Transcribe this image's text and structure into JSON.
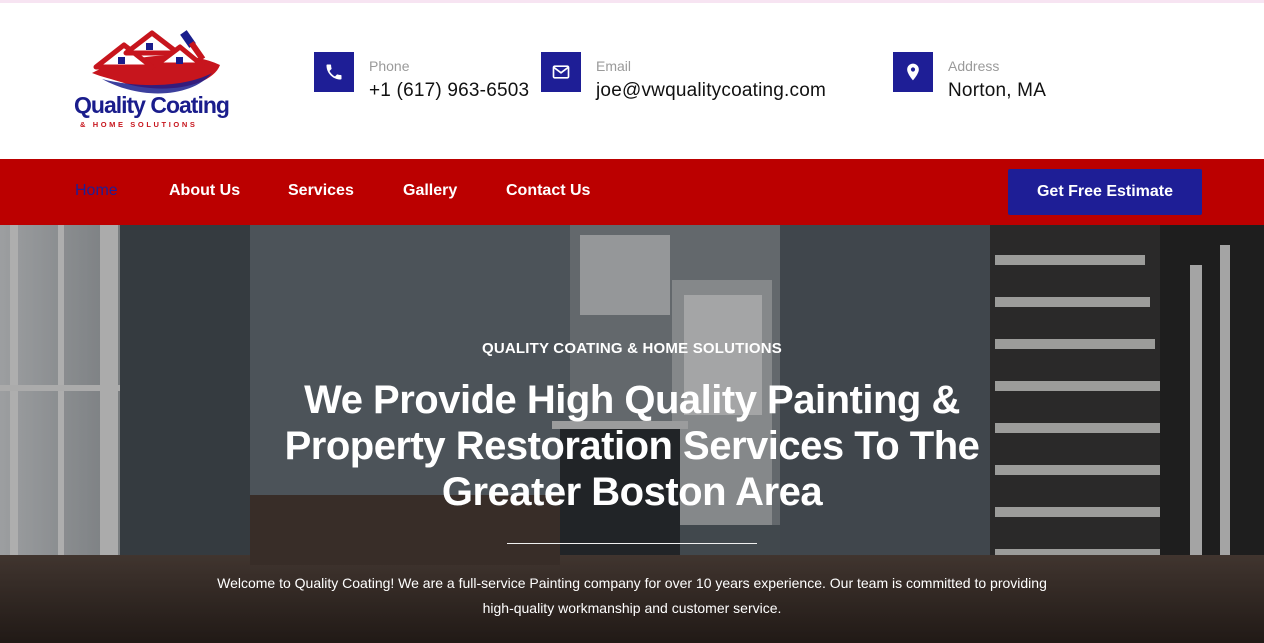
{
  "brand": {
    "name": "Quality Coating",
    "tagline": "& HOME SOLUTIONS"
  },
  "contacts": {
    "phone": {
      "label": "Phone",
      "value": "+1 (617) 963-6503",
      "icon": "phone-icon"
    },
    "email": {
      "label": "Email",
      "value": "joe@vwqualitycoating.com",
      "icon": "envelope-icon"
    },
    "address": {
      "label": "Address",
      "value": "Norton, MA",
      "icon": "map-pin-icon"
    }
  },
  "nav": {
    "items": [
      {
        "label": "Home",
        "active": true
      },
      {
        "label": "About Us"
      },
      {
        "label": "Services"
      },
      {
        "label": "Gallery"
      },
      {
        "label": "Contact Us"
      }
    ],
    "cta_label": "Get Free Estimate"
  },
  "hero": {
    "kicker": "QUALITY COATING & HOME SOLUTIONS",
    "title": "We Provide High Quality Painting & Property Restoration Services To The Greater Boston Area",
    "text": "Welcome to Quality Coating! We are a full-service Painting company for over 10 years experience. Our team is committed to providing high-quality workmanship and customer service."
  },
  "colors": {
    "brand_blue": "#1e1e96",
    "nav_red": "#bb0000",
    "logo_red": "#c7151d"
  }
}
